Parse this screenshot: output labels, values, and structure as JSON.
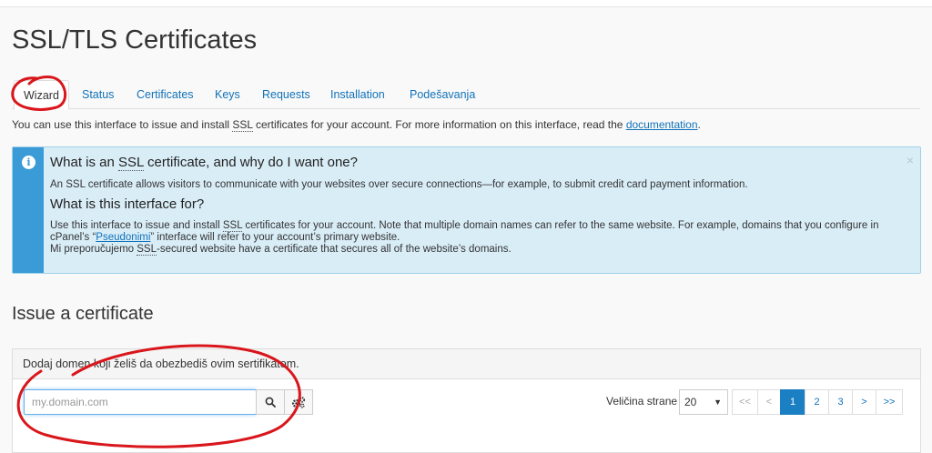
{
  "page": {
    "title": "SSL/TLS Certificates"
  },
  "tabs": [
    {
      "label": "Wizard",
      "active": true
    },
    {
      "label": "Status"
    },
    {
      "label": "Certificates"
    },
    {
      "label": "Keys"
    },
    {
      "label": "Requests"
    },
    {
      "label": "Installation"
    },
    {
      "label": "Podešavanja"
    }
  ],
  "intro": {
    "before": "You can use this interface to issue and install ",
    "ssl": "SSL",
    "middle": " certificates for your account. For more information on this interface, read the ",
    "link": "documentation",
    "after": "."
  },
  "alert": {
    "q1_before": "What is an ",
    "q1_ssl": "SSL",
    "q1_after": " certificate, and why do I want one?",
    "p1": "An SSL certificate allows visitors to communicate with your websites over secure connections—for example, to submit credit card payment information.",
    "q2": "What is this interface for?",
    "p2_a": "Use this interface to issue and install ",
    "p2_ssl": "SSL",
    "p2_b": " certificates for your account. Note that multiple domain names can refer to the same website. For example, domains that you configure in cPanel’s “",
    "p2_link": "Pseudonimi",
    "p2_c": "” interface will refer to your account’s primary website.",
    "p3_a": "Mi preporučujemo ",
    "p3_ssl": "SSL",
    "p3_b": "-secured website have a certificate that secures all of the website’s domains.",
    "close": "×",
    "info_glyph": "i"
  },
  "issue": {
    "title": "Issue a certificate",
    "panel_heading": "Dodaj domen koji želiš da obezbediš ovim sertifikatom.",
    "search_placeholder": "my.domain.com",
    "page_size_label": "Veličina strane",
    "page_size_value": "20",
    "pager": [
      "<<",
      "<",
      "1",
      "2",
      "3",
      ">",
      ">>"
    ],
    "pager_active": "1"
  },
  "colors": {
    "accent": "#1172b9",
    "alert_bg": "#d9edf7",
    "annotation": "#d9161c"
  }
}
